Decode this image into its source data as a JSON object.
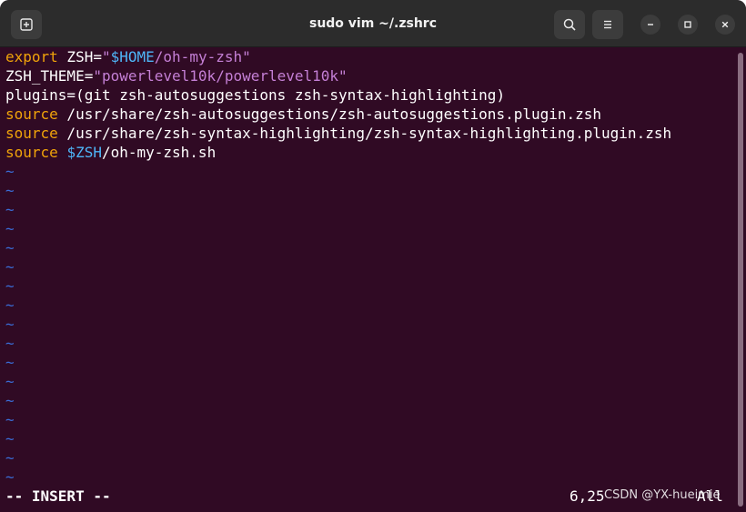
{
  "titlebar": {
    "title": "sudo vim ~/.zshrc",
    "new_tab_icon": "new-tab-icon",
    "search_icon": "search-icon",
    "menu_icon": "hamburger-menu-icon",
    "minimize_icon": "minimize-icon",
    "maximize_icon": "maximize-icon",
    "close_icon": "close-icon"
  },
  "colors": {
    "background": "#300a24",
    "keyword": "#f0a30a",
    "string": "#c47fd5",
    "variable": "#4eb5f7",
    "tilde": "#3a6cd6",
    "text": "#ffffff"
  },
  "editor": {
    "lines": [
      {
        "parts": [
          {
            "t": "export",
            "c": "kw"
          },
          {
            "t": " ZSH=",
            "c": ""
          },
          {
            "t": "\"",
            "c": "str"
          },
          {
            "t": "$HOME",
            "c": "var"
          },
          {
            "t": "/oh-my-zsh\"",
            "c": "str"
          }
        ]
      },
      {
        "parts": [
          {
            "t": "ZSH_THEME=",
            "c": ""
          },
          {
            "t": "\"powerlevel10k/powerlevel10k\"",
            "c": "str"
          }
        ]
      },
      {
        "parts": [
          {
            "t": "plugins=(git zsh-autosuggestions zsh-syntax-highlighting)",
            "c": ""
          }
        ]
      },
      {
        "parts": [
          {
            "t": "source",
            "c": "kw"
          },
          {
            "t": " /usr/share/zsh-autosuggestions/zsh-autosuggestions.plugin.zsh",
            "c": ""
          }
        ]
      },
      {
        "parts": [
          {
            "t": "source",
            "c": "kw"
          },
          {
            "t": " /usr/share/zsh-syntax-highlighting/zsh-syntax-highlighting.plugin.zsh",
            "c": ""
          }
        ]
      },
      {
        "parts": [
          {
            "t": "source",
            "c": "kw"
          },
          {
            "t": " ",
            "c": ""
          },
          {
            "t": "$ZSH",
            "c": "var"
          },
          {
            "t": "/oh-my-zsh.sh",
            "c": ""
          }
        ]
      }
    ],
    "tilde_char": "~",
    "tilde_count": 17
  },
  "statusline": {
    "mode": "-- INSERT --",
    "position": "6,25",
    "scroll": "All"
  },
  "watermark": "CSDN @YX-hueimie"
}
